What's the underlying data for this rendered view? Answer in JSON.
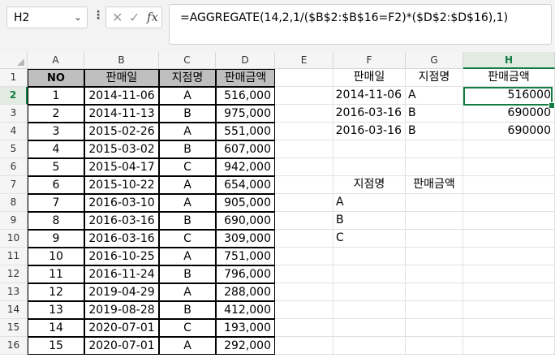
{
  "formula_bar": {
    "name_box": "H2",
    "formula": "=AGGREGATE(14,2,1/($B$2:$B$16=F2)*($D$2:$D$16),1)",
    "icons": [
      "cancel-x-icon",
      "enter-check-icon",
      "function-fx-icon"
    ]
  },
  "columns": [
    "A",
    "B",
    "C",
    "D",
    "E",
    "F",
    "G",
    "H"
  ],
  "rows": [
    "1",
    "2",
    "3",
    "4",
    "5",
    "6",
    "7",
    "8",
    "9",
    "10",
    "11",
    "12",
    "13",
    "14",
    "15",
    "16"
  ],
  "table": {
    "headers": [
      "NO",
      "판매일",
      "지점명",
      "판매금액"
    ],
    "rows": [
      [
        "1",
        "2014-11-06",
        "A",
        "516,000"
      ],
      [
        "2",
        "2014-11-13",
        "B",
        "975,000"
      ],
      [
        "3",
        "2015-02-26",
        "A",
        "551,000"
      ],
      [
        "4",
        "2015-03-02",
        "B",
        "607,000"
      ],
      [
        "5",
        "2015-04-17",
        "C",
        "942,000"
      ],
      [
        "6",
        "2015-10-22",
        "A",
        "654,000"
      ],
      [
        "7",
        "2016-03-10",
        "A",
        "905,000"
      ],
      [
        "8",
        "2016-03-16",
        "B",
        "690,000"
      ],
      [
        "9",
        "2016-03-16",
        "C",
        "309,000"
      ],
      [
        "10",
        "2016-10-25",
        "A",
        "751,000"
      ],
      [
        "11",
        "2016-11-24",
        "B",
        "796,000"
      ],
      [
        "12",
        "2019-04-29",
        "A",
        "288,000"
      ],
      [
        "13",
        "2019-08-28",
        "B",
        "412,000"
      ],
      [
        "14",
        "2020-07-01",
        "C",
        "193,000"
      ],
      [
        "15",
        "2020-07-01",
        "A",
        "292,000"
      ]
    ]
  },
  "result1": {
    "headers": [
      "판매일",
      "지점명",
      "판매금액"
    ],
    "rows": [
      [
        "2014-11-06",
        "A",
        "516000"
      ],
      [
        "2016-03-16",
        "B",
        "690000"
      ],
      [
        "2016-03-16",
        "B",
        "690000"
      ]
    ]
  },
  "result2": {
    "headers": [
      "지점명",
      "판매금액"
    ],
    "branches": [
      "A",
      "B",
      "C"
    ]
  },
  "selection": {
    "cell": "H2",
    "accent": "#107c41"
  }
}
